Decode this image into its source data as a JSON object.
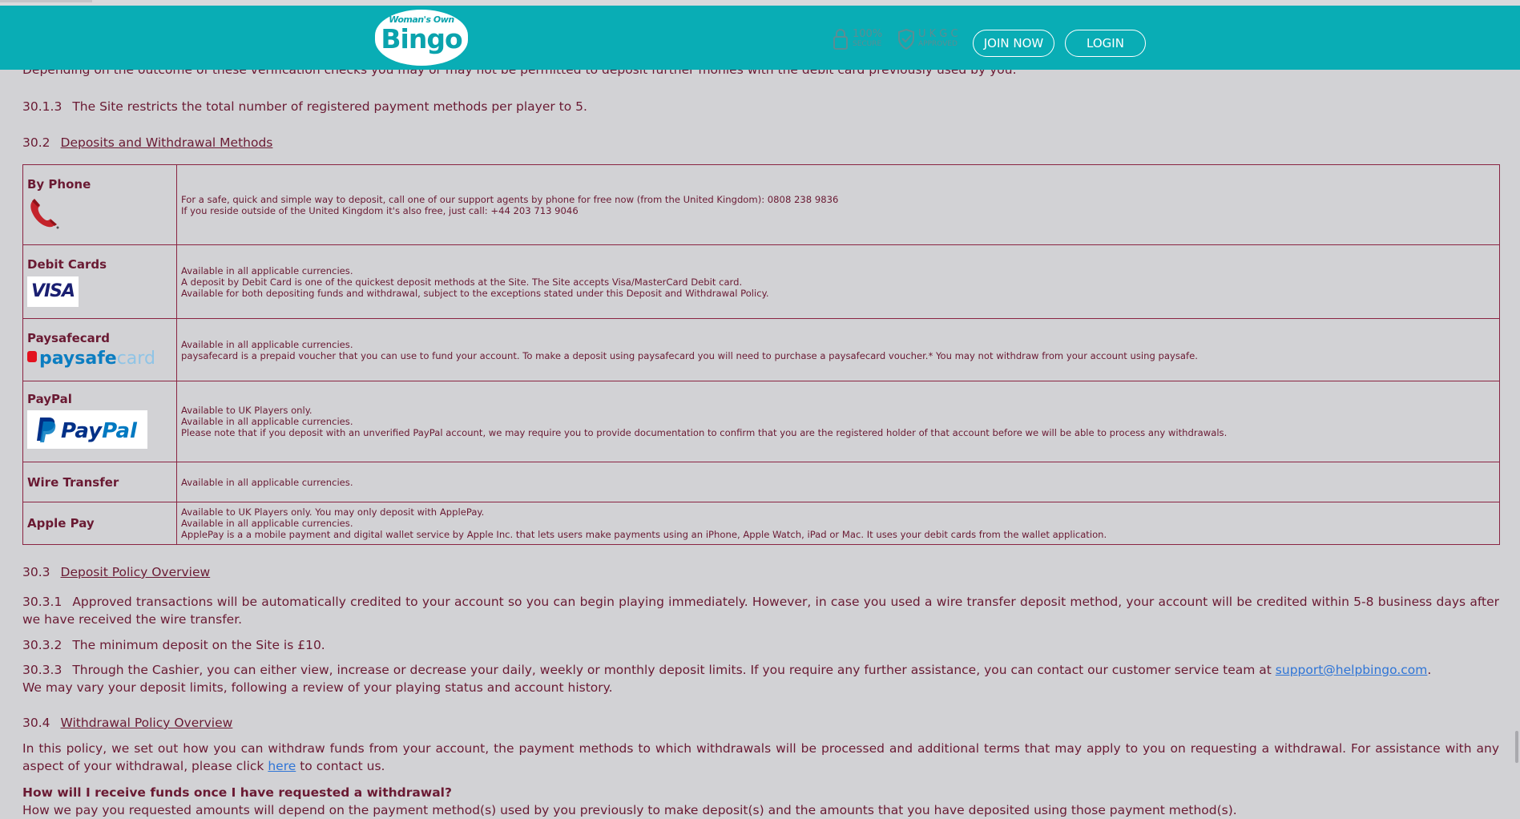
{
  "header": {
    "logo_top": "Woman's Own",
    "logo_main": "Bingo",
    "badge_secure_big": "100%",
    "badge_secure_small": "SECURE",
    "badge_ukgc_big": "U K G C",
    "badge_ukgc_small": "APPROVED",
    "join_label": "JOIN NOW",
    "login_label": "LOGIN"
  },
  "colors": {
    "header_bg": "#09adb5",
    "page_bg": "#d2d2d5",
    "text": "#6a1a33",
    "link": "#2f75d6"
  },
  "cut_line": "Depending on the outcome of these verification checks you may or may not be permitted to deposit further monies with the debit card previously used by you.",
  "s30_1_3": {
    "num": "30.1.3",
    "text": "The Site restricts the total number of registered payment methods per player to 5."
  },
  "s30_2": {
    "num": "30.2",
    "title": "Deposits and Withdrawal Methods"
  },
  "methods": [
    {
      "name": "By Phone",
      "icon": "phone-icon",
      "lines": [
        "For a safe, quick and simple way to deposit, call one of our support agents by phone for free now (from the United Kingdom): 0808 238 9836",
        "If you reside outside of the United Kingdom it's also free, just call: +44 203 713 9046"
      ]
    },
    {
      "name": "Debit Cards",
      "icon": "visa-logo",
      "logo_text": "VISA",
      "lines": [
        "Available in all applicable currencies.",
        "A deposit by Debit Card is one of the quickest deposit methods at the Site. The Site accepts Visa/MasterCard Debit card.",
        "Available for both depositing funds and withdrawal, subject to the exceptions stated under this Deposit and Withdrawal Policy."
      ]
    },
    {
      "name": "Paysafecard",
      "icon": "paysafecard-logo",
      "logo_text_a": "paysafe",
      "logo_text_b": "card",
      "lines": [
        "Available in all applicable currencies.",
        "paysafecard is a prepaid voucher that you can use to fund your account. To make a deposit using paysafecard you will need to purchase a paysafecard voucher.* You may not withdraw from your account using paysafe."
      ]
    },
    {
      "name": "PayPal",
      "icon": "paypal-logo",
      "logo_text_a": "Pay",
      "logo_text_b": "Pal",
      "lines": [
        "Available to UK Players only.",
        "Available in all applicable currencies.",
        "Please note that if you deposit with an unverified PayPal account, we may require you to provide documentation to confirm that you are the registered holder of that account before we will be able to process any withdrawals."
      ]
    },
    {
      "name": "Wire Transfer",
      "lines": [
        "Available in all applicable currencies."
      ]
    },
    {
      "name": "Apple Pay",
      "lines": [
        "Available to UK Players only. You may only deposit with ApplePay.",
        "Available in all applicable currencies.",
        "ApplePay is a a mobile payment and digital wallet service by Apple Inc. that lets users make payments using an iPhone, Apple Watch, iPad or Mac. It uses your debit cards from the wallet application."
      ]
    }
  ],
  "s30_3": {
    "num": "30.3",
    "title": "Deposit Policy Overview"
  },
  "s30_3_1": {
    "num": "30.3.1",
    "text": "Approved transactions will be automatically credited to your account so you can begin playing immediately. However, in case you used a wire transfer deposit method, your account will be credited within 5-8 business days after we have received the wire transfer."
  },
  "s30_3_2": {
    "num": "30.3.2",
    "text": "The minimum deposit on the Site is £10."
  },
  "s30_3_3": {
    "num": "30.3.3",
    "text_before": "Through the Cashier, you can either view, increase or decrease your daily, weekly or monthly deposit limits. If you require any further assistance, you can contact our customer service team at ",
    "email": "support@helpbingo.com",
    "text_after": ".",
    "line2": "We may vary your deposit limits, following a review of your playing status and account history."
  },
  "s30_4": {
    "num": "30.4",
    "title": "Withdrawal Policy Overview"
  },
  "withdraw_intro": {
    "before": "In this policy, we set out how you can withdraw funds from your account, the payment methods to which withdrawals will be processed and additional terms that may apply to you on requesting a withdrawal. For assistance with any aspect of your withdrawal, please click ",
    "link": "here",
    "after": " to contact us."
  },
  "question": "How will I receive funds once I have requested a withdrawal?",
  "cut_bottom": "How we pay you requested amounts will depend on the payment method(s) used by you previously to make deposit(s) and the amounts that you have deposited using those payment method(s)."
}
